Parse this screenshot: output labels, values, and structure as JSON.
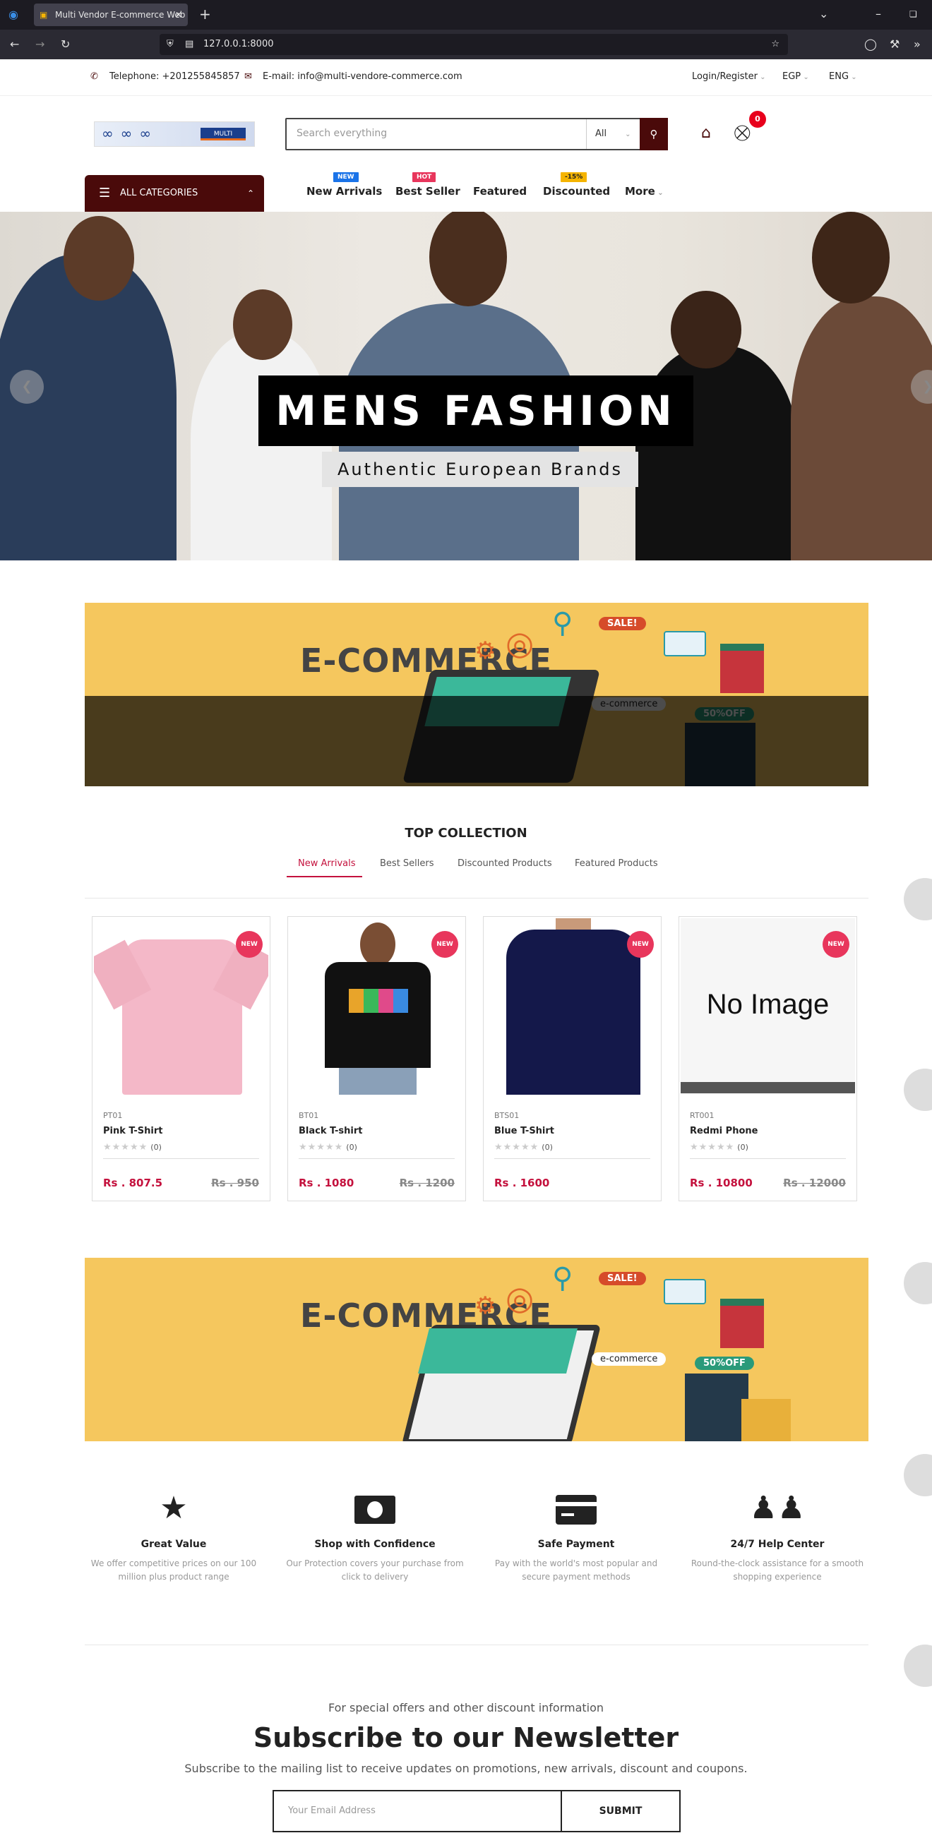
{
  "browser": {
    "tab_title": "Multi Vendor E-commerce Web",
    "url": "127.0.0.1:8000"
  },
  "topbar": {
    "telephone": "Telephone: +201255845857",
    "email": "E-mail: info@multi-vendore-commerce.com",
    "login": "Login/Register",
    "currency": "EGP",
    "language": "ENG"
  },
  "header": {
    "logo_text": "MULTI",
    "search_placeholder": "Search everything",
    "search_category": "All",
    "cart_count": "0"
  },
  "nav": {
    "all_categories": "ALL CATEGORIES",
    "items": [
      {
        "label": "New Arrivals",
        "badge": "NEW",
        "badge_color": "#1a73e8"
      },
      {
        "label": "Best Seller",
        "badge": "HOT",
        "badge_color": "#e8365c"
      },
      {
        "label": "Featured",
        "badge": "",
        "badge_color": ""
      },
      {
        "label": "Discounted",
        "badge": "-15%",
        "badge_color": "#f5b400"
      },
      {
        "label": "More",
        "badge": "",
        "badge_color": ""
      }
    ]
  },
  "hero": {
    "title": "MENS FASHION",
    "subtitle": "Authentic European Brands"
  },
  "banner": {
    "heading": "E-COMMERCE",
    "sale": "SALE!",
    "ecommerce_tag": "e-commerce",
    "off_tag": "50%OFF"
  },
  "collection": {
    "title": "TOP COLLECTION",
    "tabs": [
      "New Arrivals",
      "Best Sellers",
      "Discounted Products",
      "Featured Products"
    ],
    "active_tab": "New Arrivals"
  },
  "products": [
    {
      "sku": "PT01",
      "name": "Pink T-Shirt",
      "price": "Rs . 807.5",
      "old_price": "Rs . 950",
      "reviews": "(0)",
      "badge": "NEW"
    },
    {
      "sku": "BT01",
      "name": "Black T-shirt",
      "price": "Rs . 1080",
      "old_price": "Rs . 1200",
      "reviews": "(0)",
      "badge": "NEW"
    },
    {
      "sku": "BTS01",
      "name": "Blue T-Shirt",
      "price": "Rs . 1600",
      "old_price": "",
      "reviews": "(0)",
      "badge": "NEW"
    },
    {
      "sku": "RT001",
      "name": "Redmi Phone",
      "price": "Rs . 10800",
      "old_price": "Rs . 12000",
      "reviews": "(0)",
      "badge": "NEW",
      "image_text": "No Image"
    }
  ],
  "features": [
    {
      "title": "Great Value",
      "desc": "We offer competitive prices on our 100 million plus product range",
      "icon": "star-icon"
    },
    {
      "title": "Shop with Confidence",
      "desc": "Our Protection covers your purchase from click to delivery",
      "icon": "money-icon"
    },
    {
      "title": "Safe Payment",
      "desc": "Pay with the world's most popular and secure payment methods",
      "icon": "credit-card-icon"
    },
    {
      "title": "24/7 Help Center",
      "desc": "Round-the-clock assistance for a smooth shopping experience",
      "icon": "users-icon"
    }
  ],
  "newsletter": {
    "pre": "For special offers and other discount information",
    "title": "Subscribe to our Newsletter",
    "desc": "Subscribe to the mailing list to receive updates on promotions, new arrivals, discount and coupons.",
    "placeholder": "Your Email Address",
    "submit": "SUBMIT"
  }
}
